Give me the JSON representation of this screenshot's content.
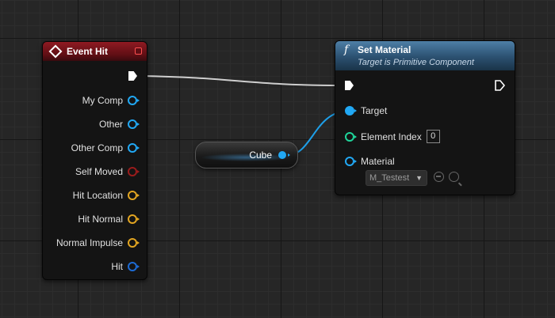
{
  "event_hit": {
    "title": "Event Hit",
    "outputs": [
      {
        "label": "My Comp",
        "type": "object"
      },
      {
        "label": "Other",
        "type": "object"
      },
      {
        "label": "Other Comp",
        "type": "object"
      },
      {
        "label": "Self Moved",
        "type": "bool"
      },
      {
        "label": "Hit Location",
        "type": "struct"
      },
      {
        "label": "Hit Normal",
        "type": "struct"
      },
      {
        "label": "Normal Impulse",
        "type": "struct"
      },
      {
        "label": "Hit",
        "type": "hit"
      }
    ]
  },
  "cube_node": {
    "label": "Cube"
  },
  "set_material": {
    "title": "Set Material",
    "subtitle": "Target is Primitive Component",
    "target_label": "Target",
    "element_index_label": "Element Index",
    "element_index_value": "0",
    "material_label": "Material",
    "material_value": "M_Testest"
  },
  "icons": {
    "event": "diamond-icon",
    "function": "f",
    "delegate": "delegate-icon"
  },
  "colors": {
    "event_header": "#8f1a22",
    "function_header": "#4e7fa6",
    "object_pin": "#21a8f4",
    "bool_pin": "#9a1c1c",
    "struct_pin": "#e2a521",
    "hit_pin": "#1d6bd4",
    "int_pin": "#1fd49a",
    "exec_wire": "#d0d0d0"
  }
}
